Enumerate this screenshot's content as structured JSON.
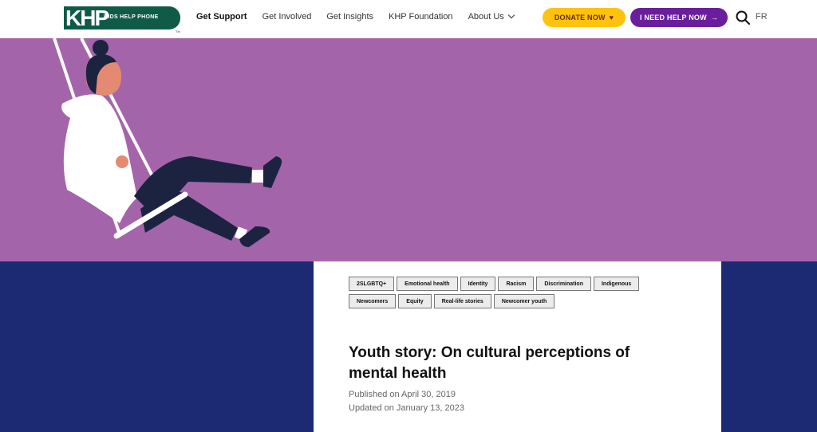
{
  "logo": {
    "letters": "KHP",
    "text": "KIDS HELP PHONE",
    "tm": "TM"
  },
  "nav": {
    "items": [
      "Get Support",
      "Get Involved",
      "Get Insights",
      "KHP Foundation",
      "About Us"
    ]
  },
  "buttons": {
    "donate": "DONATE NOW",
    "help": "I NEED HELP NOW"
  },
  "language": "FR",
  "colors": {
    "brand_green": "#0f5b48",
    "donate_yellow": "#ffc20e",
    "help_purple": "#6a1e9c",
    "hero_purple": "#a464aa",
    "navy": "#1b2a72"
  },
  "icons": [
    "search-icon",
    "heart-icon",
    "arrow-right-icon",
    "chevron-down-icon"
  ],
  "article": {
    "tags_row1": [
      "2SLGBTQ+",
      "Emotional health",
      "Identity",
      "Racism",
      "Discrimination",
      "Indigenous"
    ],
    "tags_row2": [
      "Newcomers",
      "Equity",
      "Real-life stories",
      "Newcomer youth"
    ],
    "title": "Youth story: On cultural perceptions of mental health",
    "published": "Published on April 30, 2019",
    "updated": "Updated on January 13, 2023"
  }
}
